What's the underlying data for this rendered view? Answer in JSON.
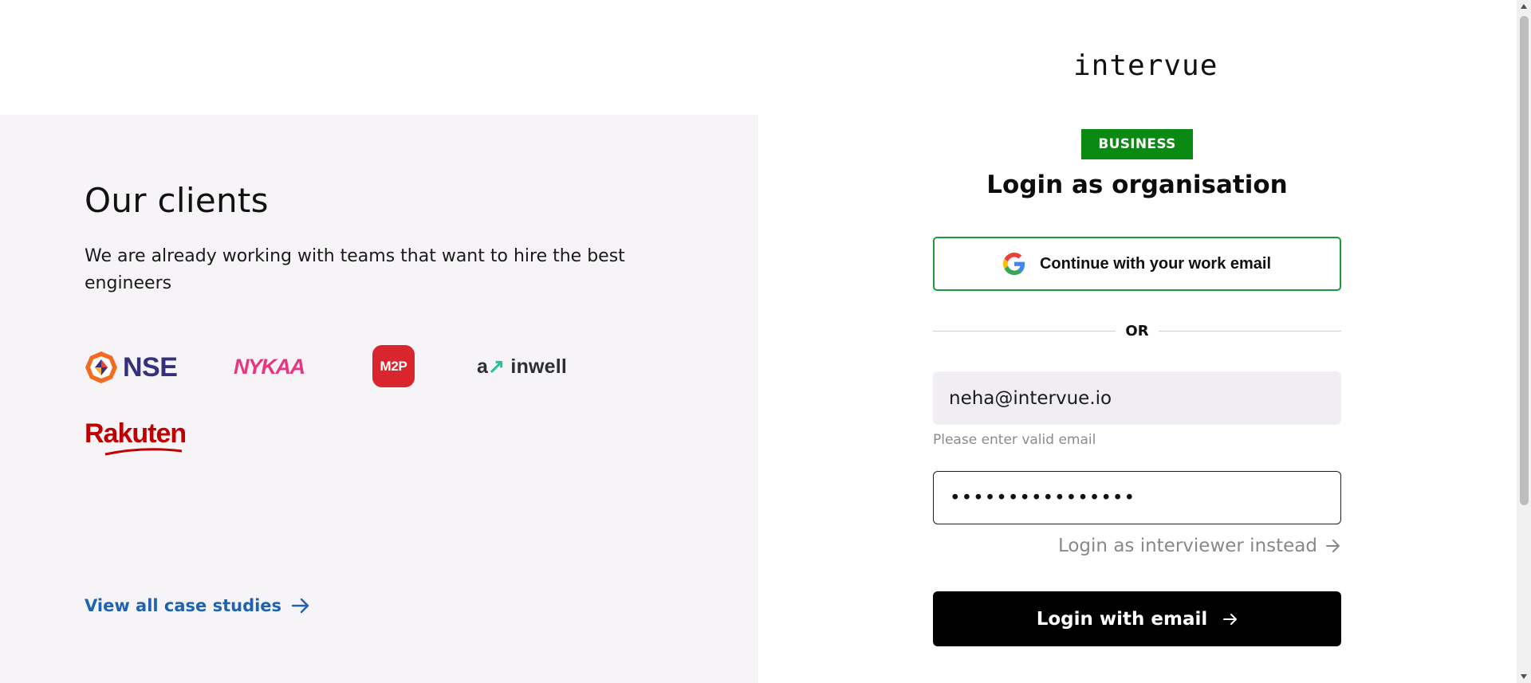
{
  "brand": {
    "logo_text": "intervue"
  },
  "left": {
    "title": "Our clients",
    "subtitle": "We are already working with teams that want to hire the best engineers",
    "logos": {
      "nse": "NSE",
      "nykaa": "NYKAA",
      "m2p": "M2P",
      "gainwell_mark": "a",
      "gainwell_rest": "inwell",
      "rakuten": "Rakuten"
    },
    "case_studies_link": "View all case studies",
    "case_studies_icon": "arrow-right-icon"
  },
  "login": {
    "badge": "BUSINESS",
    "title": "Login as organisation",
    "google_button": "Continue with your work email",
    "google_icon": "google-g-icon",
    "divider": "OR",
    "email_value": "neha@intervue.io",
    "email_error": "Please enter valid email",
    "password_value": "••••••••••••••••",
    "interviewer_link": "Login as interviewer instead",
    "submit": "Login with email"
  },
  "colors": {
    "badge_green": "#0a8a12",
    "google_border": "#1a9b3a",
    "link_blue": "#1d63b0",
    "left_bg": "#f6f4f7",
    "input_bg": "#f0eef3"
  }
}
